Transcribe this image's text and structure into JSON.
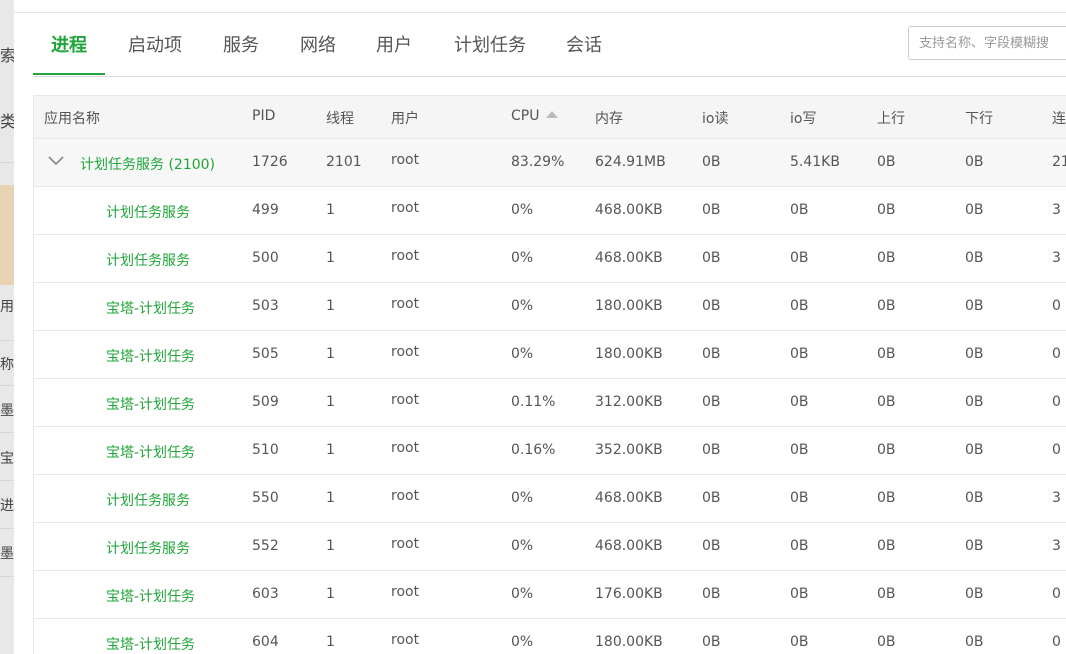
{
  "left_strip": [
    "索",
    "类",
    "用",
    "称",
    "墨",
    "宝",
    "进",
    "墨"
  ],
  "tabs": [
    "进程",
    "启动项",
    "服务",
    "网络",
    "用户",
    "计划任务",
    "会话"
  ],
  "search": {
    "placeholder": "支持名称、字段模糊搜"
  },
  "columns": [
    "应用名称",
    "PID",
    "线程",
    "用户",
    "CPU",
    "内存",
    "io读",
    "io写",
    "上行",
    "下行",
    "连"
  ],
  "parent_row": {
    "name": "计划任务服务 (2100)",
    "pid": "1726",
    "threads": "2101",
    "user": "root",
    "cpu": "83.29%",
    "mem": "624.91MB",
    "io_read": "0B",
    "io_write": "5.41KB",
    "up": "0B",
    "down": "0B",
    "conn": "21"
  },
  "rows": [
    {
      "name": "计划任务服务",
      "pid": "499",
      "threads": "1",
      "user": "root",
      "cpu": "0%",
      "mem": "468.00KB",
      "io_read": "0B",
      "io_write": "0B",
      "up": "0B",
      "down": "0B",
      "conn": "3"
    },
    {
      "name": "计划任务服务",
      "pid": "500",
      "threads": "1",
      "user": "root",
      "cpu": "0%",
      "mem": "468.00KB",
      "io_read": "0B",
      "io_write": "0B",
      "up": "0B",
      "down": "0B",
      "conn": "3"
    },
    {
      "name": "宝塔-计划任务",
      "pid": "503",
      "threads": "1",
      "user": "root",
      "cpu": "0%",
      "mem": "180.00KB",
      "io_read": "0B",
      "io_write": "0B",
      "up": "0B",
      "down": "0B",
      "conn": "0"
    },
    {
      "name": "宝塔-计划任务",
      "pid": "505",
      "threads": "1",
      "user": "root",
      "cpu": "0%",
      "mem": "180.00KB",
      "io_read": "0B",
      "io_write": "0B",
      "up": "0B",
      "down": "0B",
      "conn": "0"
    },
    {
      "name": "宝塔-计划任务",
      "pid": "509",
      "threads": "1",
      "user": "root",
      "cpu": "0.11%",
      "mem": "312.00KB",
      "io_read": "0B",
      "io_write": "0B",
      "up": "0B",
      "down": "0B",
      "conn": "0"
    },
    {
      "name": "宝塔-计划任务",
      "pid": "510",
      "threads": "1",
      "user": "root",
      "cpu": "0.16%",
      "mem": "352.00KB",
      "io_read": "0B",
      "io_write": "0B",
      "up": "0B",
      "down": "0B",
      "conn": "0"
    },
    {
      "name": "计划任务服务",
      "pid": "550",
      "threads": "1",
      "user": "root",
      "cpu": "0%",
      "mem": "468.00KB",
      "io_read": "0B",
      "io_write": "0B",
      "up": "0B",
      "down": "0B",
      "conn": "3"
    },
    {
      "name": "计划任务服务",
      "pid": "552",
      "threads": "1",
      "user": "root",
      "cpu": "0%",
      "mem": "468.00KB",
      "io_read": "0B",
      "io_write": "0B",
      "up": "0B",
      "down": "0B",
      "conn": "3"
    },
    {
      "name": "宝塔-计划任务",
      "pid": "603",
      "threads": "1",
      "user": "root",
      "cpu": "0%",
      "mem": "176.00KB",
      "io_read": "0B",
      "io_write": "0B",
      "up": "0B",
      "down": "0B",
      "conn": "0"
    },
    {
      "name": "宝塔-计划任务",
      "pid": "604",
      "threads": "1",
      "user": "root",
      "cpu": "0%",
      "mem": "180.00KB",
      "io_read": "0B",
      "io_write": "0B",
      "up": "0B",
      "down": "0B",
      "conn": "0"
    }
  ]
}
